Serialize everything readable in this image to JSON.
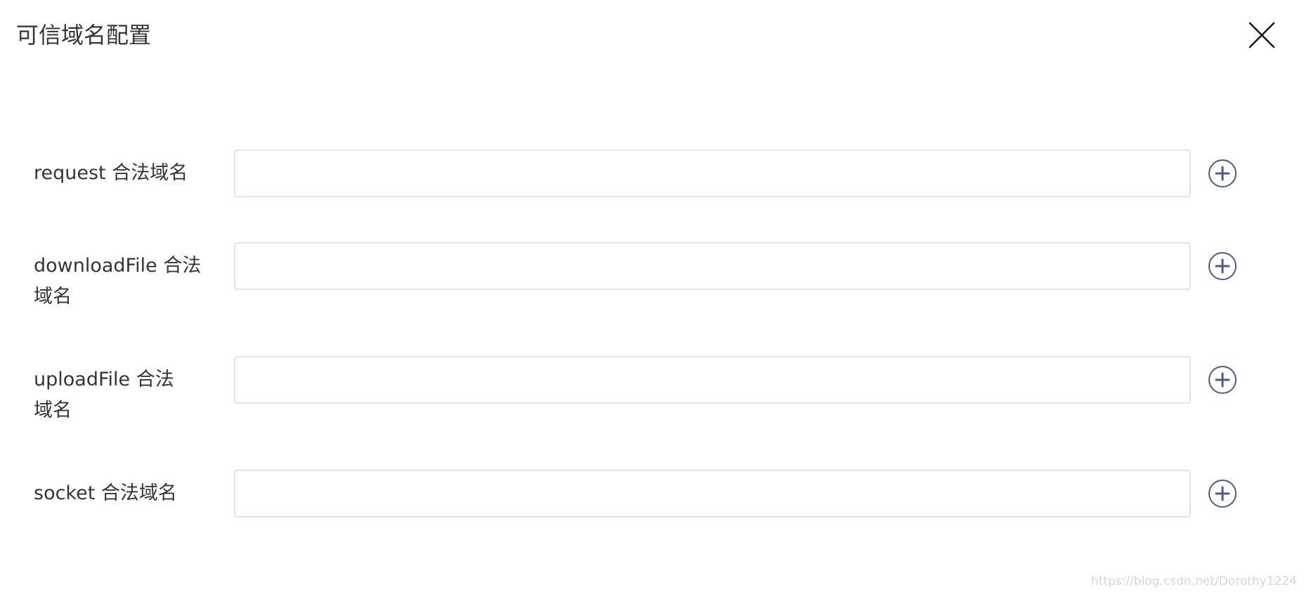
{
  "dialog": {
    "title": "可信域名配置",
    "close_icon": "close-icon"
  },
  "rows": [
    {
      "label": "request 合法域名",
      "value": "",
      "placeholder": "",
      "add_icon": "plus-circle-icon"
    },
    {
      "label": "downloadFile 合法域名",
      "value": "",
      "placeholder": "",
      "add_icon": "plus-circle-icon"
    },
    {
      "label": "uploadFile 合法域名",
      "value": "",
      "placeholder": "",
      "add_icon": "plus-circle-icon"
    },
    {
      "label": "socket 合法域名",
      "value": "",
      "placeholder": "",
      "add_icon": "plus-circle-icon"
    }
  ],
  "watermark": "https://blog.csdn.net/Dorothy1224",
  "colors": {
    "text": "#353535",
    "input_border": "#e4e4e4",
    "add_icon": "#4a5d88",
    "close_icon": "#1a1a1a",
    "watermark": "#d6d6d6"
  }
}
